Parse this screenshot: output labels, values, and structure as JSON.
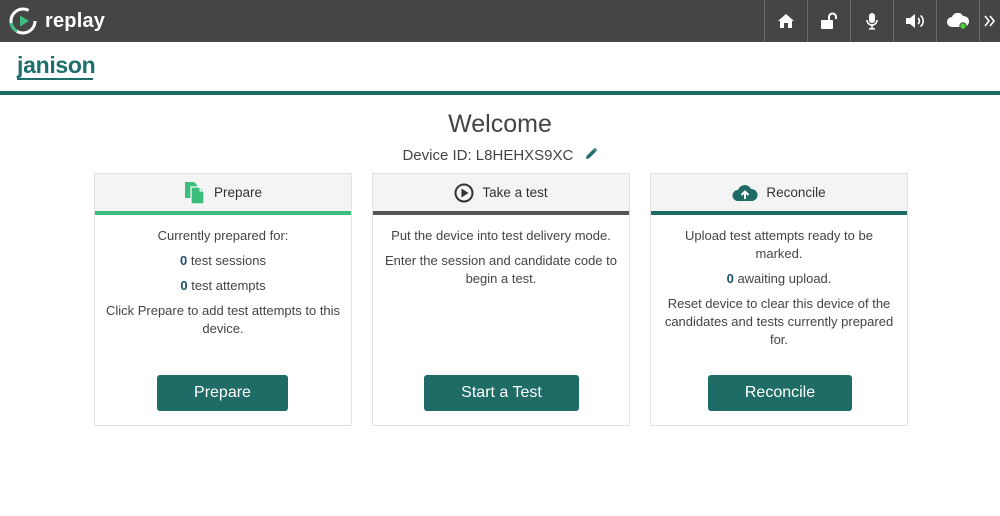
{
  "topbar": {
    "app_name": "replay",
    "icons": [
      "home-icon",
      "unlock-icon",
      "microphone-icon",
      "volume-icon",
      "cloud-status-icon",
      "chevron-double-right-icon"
    ]
  },
  "brand": {
    "name": "janison"
  },
  "welcome": {
    "title": "Welcome",
    "device_label": "Device ID: L8HEHXS9XC"
  },
  "cards": [
    {
      "title": "Prepare",
      "icon": "documents-icon",
      "line1": "Currently prepared for:",
      "sessions_count": "0",
      "sessions_label": " test sessions",
      "attempts_count": "0",
      "attempts_label": " test attempts",
      "line4": "Click Prepare to add test attempts to this device.",
      "button": "Prepare"
    },
    {
      "title": "Take a test",
      "icon": "play-circle-icon",
      "line1": "Put the device into test delivery mode.",
      "line2": "Enter the session and candidate code to begin a test.",
      "button": "Start a Test"
    },
    {
      "title": "Reconcile",
      "icon": "cloud-upload-icon",
      "line1": "Upload test attempts ready to be marked.",
      "awaiting_count": "0",
      "awaiting_label": " awaiting upload.",
      "line3": "Reset device to clear this device of the candidates and tests currently prepared for.",
      "button": "Reconcile"
    }
  ],
  "colors": {
    "topbar": "#454545",
    "accent": "#1f6b66",
    "prepare_accent": "#3dbd7d",
    "take_test_accent": "#555555"
  }
}
